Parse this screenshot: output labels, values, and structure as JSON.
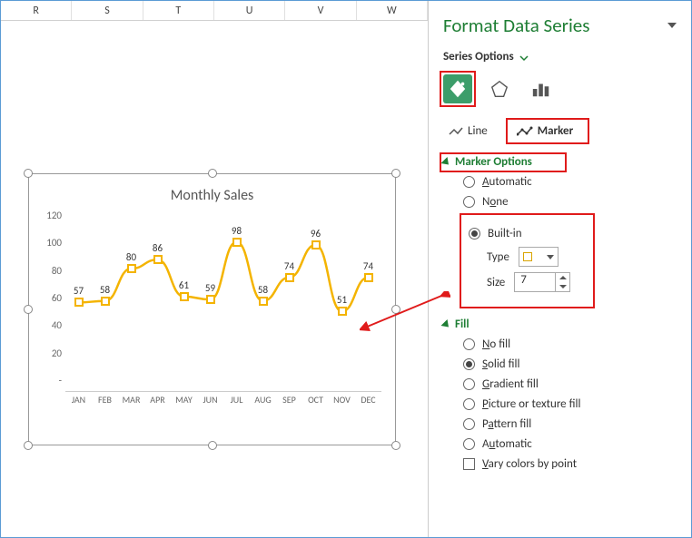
{
  "columns": [
    "R",
    "S",
    "T",
    "U",
    "V",
    "W"
  ],
  "panel": {
    "title": "Format Data Series",
    "series_options": "Series Options",
    "tabs": {
      "line": "Line",
      "marker": "Marker"
    },
    "marker_options": {
      "heading": "Marker Options",
      "automatic": "Automatic",
      "none": "None",
      "builtin": "Built-in",
      "type_label": "Type",
      "size_label": "Size",
      "size_value": "7"
    },
    "fill": {
      "heading": "Fill",
      "options": {
        "no": "No fill",
        "solid": "Solid fill",
        "gradient": "Gradient fill",
        "picture": "Picture or texture fill",
        "pattern": "Pattern fill",
        "automatic": "Automatic",
        "vary": "Vary colors by point"
      }
    }
  },
  "chart_data": {
    "type": "line",
    "title": "Monthly Sales",
    "categories": [
      "JAN",
      "FEB",
      "MAR",
      "APR",
      "MAY",
      "JUN",
      "JUL",
      "AUG",
      "SEP",
      "OCT",
      "NOV",
      "DEC"
    ],
    "values": [
      57,
      58,
      80,
      86,
      61,
      59,
      98,
      58,
      74,
      96,
      51,
      74
    ],
    "ylim": [
      0,
      120
    ],
    "yticks": [
      0,
      20,
      40,
      60,
      80,
      100,
      120
    ],
    "ytick_labels": [
      "-",
      "20",
      "40",
      "60",
      "80",
      "100",
      "120"
    ],
    "xlabel": "",
    "ylabel": ""
  }
}
